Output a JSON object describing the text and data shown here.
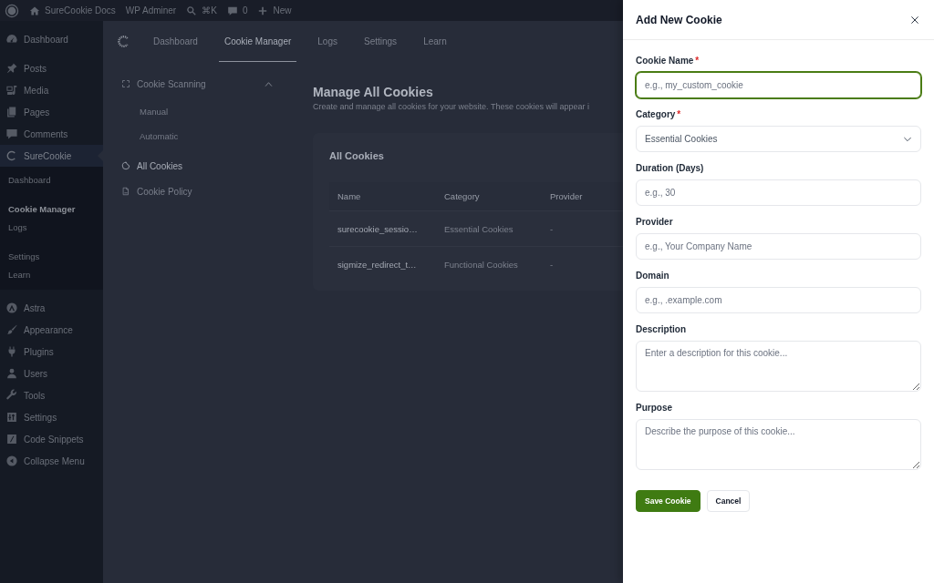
{
  "admin_bar": {
    "items": [
      {
        "kind": "home",
        "label": "SureCookie Docs"
      },
      {
        "kind": "text",
        "label": "WP Adminer"
      },
      {
        "kind": "search",
        "label": "⌘K"
      },
      {
        "kind": "comments",
        "label": "0"
      },
      {
        "kind": "new",
        "label": "New"
      }
    ]
  },
  "sidebar": {
    "menu_groups": [
      {
        "items": [
          {
            "kind": "dashboard",
            "label": "Dashboard",
            "selected": false
          }
        ]
      },
      {
        "items": [
          {
            "kind": "posts",
            "label": "Posts",
            "selected": false
          },
          {
            "kind": "media",
            "label": "Media",
            "selected": false
          },
          {
            "kind": "pages",
            "label": "Pages",
            "selected": false
          },
          {
            "kind": "comments",
            "label": "Comments",
            "selected": false
          },
          {
            "kind": "surecookie",
            "label": "SureCookie",
            "selected": true,
            "submenu_groups": [
              {
                "items": [
                  {
                    "label": "Dashboard",
                    "selected": false
                  }
                ]
              },
              {
                "items": [
                  {
                    "label": "Cookie Manager",
                    "selected": true
                  },
                  {
                    "label": "Logs",
                    "selected": false
                  }
                ]
              },
              {
                "items": [
                  {
                    "label": "Settings",
                    "selected": false
                  },
                  {
                    "label": "Learn",
                    "selected": false
                  }
                ]
              }
            ]
          }
        ]
      },
      {
        "items": [
          {
            "kind": "astra",
            "label": "Astra",
            "selected": false
          },
          {
            "kind": "appearance",
            "label": "Appearance",
            "selected": false
          },
          {
            "kind": "plugins",
            "label": "Plugins",
            "selected": false
          },
          {
            "kind": "users",
            "label": "Users",
            "selected": false
          },
          {
            "kind": "tools",
            "label": "Tools",
            "selected": false
          },
          {
            "kind": "settings",
            "label": "Settings",
            "selected": false
          },
          {
            "kind": "snippets",
            "label": "Code Snippets",
            "selected": false
          },
          {
            "kind": "collapse",
            "label": "Collapse Menu",
            "selected": false
          }
        ]
      }
    ]
  },
  "plugin_header": {
    "tabs": [
      {
        "label": "Dashboard",
        "selected": false
      },
      {
        "label": "Cookie Manager",
        "selected": true
      },
      {
        "label": "Logs",
        "selected": false
      },
      {
        "label": "Settings",
        "selected": false
      },
      {
        "label": "Learn",
        "selected": false
      }
    ]
  },
  "plugin_nav": {
    "items": [
      {
        "kind": "scan",
        "label": "Cookie Scanning",
        "selected": false,
        "expanded": true,
        "children": [
          {
            "label": "Manual",
            "selected": false
          },
          {
            "label": "Automatic",
            "selected": false
          }
        ]
      },
      {
        "kind": "cookie",
        "label": "All Cookies",
        "selected": true
      },
      {
        "kind": "document",
        "label": "Cookie Policy",
        "selected": false
      }
    ]
  },
  "main": {
    "title": "Manage All Cookies",
    "description": "Create and manage all cookies for your website. These cookies will appear i",
    "card": {
      "title": "All Cookies",
      "table": {
        "columns": [
          "Name",
          "Category",
          "Provider"
        ],
        "rows": [
          [
            "surecookie_sessio…",
            "Essential Cookies",
            "-"
          ],
          [
            "sigmize_redirect_t…",
            "Functional Cookies",
            "-"
          ]
        ]
      }
    }
  },
  "drawer": {
    "title": "Add New Cookie",
    "fields": [
      {
        "kind": "input",
        "label": "Cookie Name",
        "required_mark": "*",
        "placeholder": "e.g., my_custom_cookie",
        "focused": true
      },
      {
        "kind": "select",
        "label": "Category",
        "required_mark": "*",
        "value": "Essential Cookies",
        "focused": false
      },
      {
        "kind": "input",
        "label": "Duration (Days)",
        "placeholder": "e.g., 30",
        "focused": false
      },
      {
        "kind": "input",
        "label": "Provider",
        "placeholder": "e.g., Your Company Name",
        "focused": false
      },
      {
        "kind": "input",
        "label": "Domain",
        "placeholder": "e.g., .example.com",
        "focused": false
      },
      {
        "kind": "textarea",
        "label": "Description",
        "placeholder": "Enter a description for this cookie...",
        "focused": false
      },
      {
        "kind": "textarea",
        "label": "Purpose",
        "placeholder": "Describe the purpose of this cookie...",
        "focused": false
      }
    ],
    "buttons": [
      {
        "kind": "primary",
        "label": "Save Cookie"
      },
      {
        "kind": "secondary",
        "label": "Cancel"
      }
    ]
  }
}
